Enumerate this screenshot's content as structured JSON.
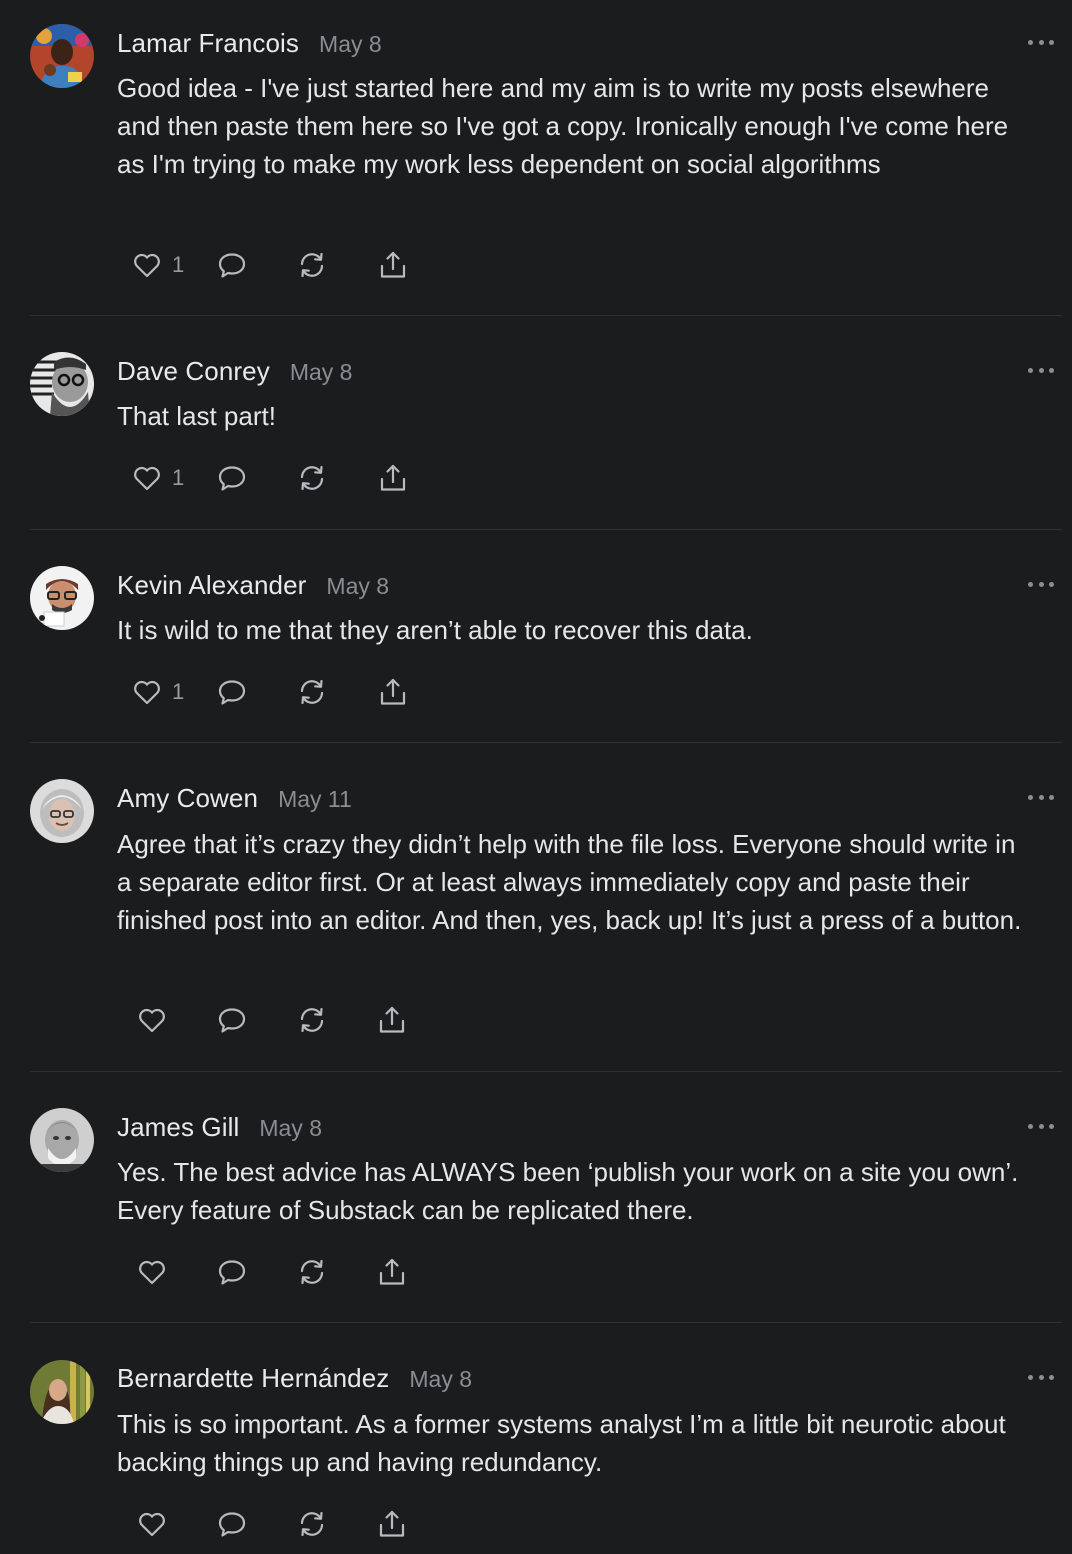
{
  "comments": [
    {
      "author": "Lamar Francois",
      "date": "May 8",
      "text": "Good idea - I've just started here and my aim is to write my posts elsewhere and then paste them here so I've got a copy. Ironically enough I've come here as I'm trying to make my work less dependent on social algorithms",
      "likes": "1"
    },
    {
      "author": "Dave Conrey",
      "date": "May 8",
      "text": "That last part!",
      "likes": "1"
    },
    {
      "author": "Kevin Alexander",
      "date": "May 8",
      "text": "It is wild to me that they aren’t able to recover this data.",
      "likes": "1"
    },
    {
      "author": "Amy Cowen",
      "date": "May 11",
      "text": "Agree that it’s crazy they didn’t help with the file loss. Everyone should write in a separate editor first. Or at least always immediately copy and paste their finished post into an editor. And then, yes, back up! It’s just a press of a button.",
      "likes": ""
    },
    {
      "author": "James Gill",
      "date": "May 8",
      "text": "Yes. The best advice has ALWAYS been ‘publish your work on a site you own’. Every feature of Substack can be replicated there.",
      "likes": ""
    },
    {
      "author": "Bernardette Hernández",
      "date": "May 8",
      "text": "This is so important. As a former systems analyst I’m a little bit neurotic about backing things up and having redundancy.",
      "likes": ""
    }
  ],
  "icons": {
    "like": "heart-icon",
    "reply": "comment-bubble-icon",
    "restack": "restack-arrows-icon",
    "share": "share-upload-icon",
    "more": "ellipsis-icon"
  },
  "colors": {
    "background": "#1b1c1e",
    "text": "#e6e6e7",
    "muted": "#8c8d91",
    "divider": "#303134"
  }
}
